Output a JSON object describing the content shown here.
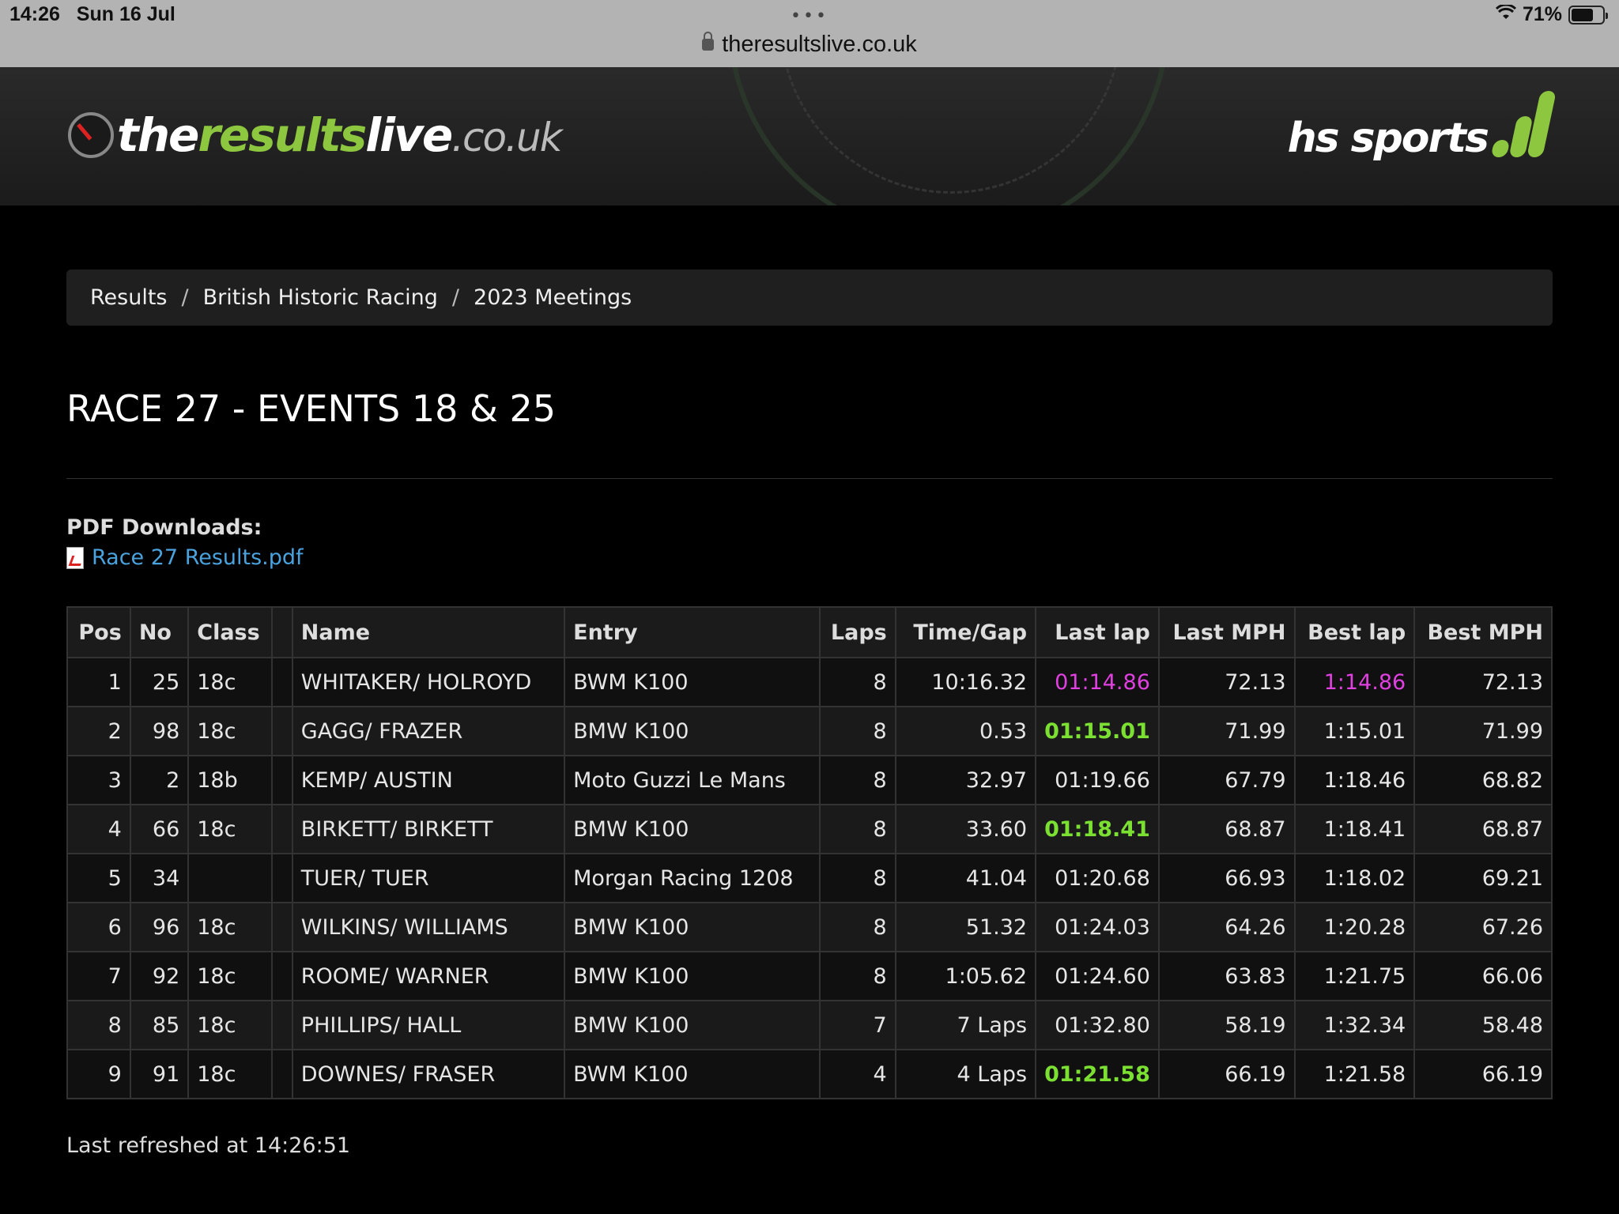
{
  "status_bar": {
    "time": "14:26",
    "date": "Sun 16 Jul",
    "battery": "71%",
    "battery_level": 0.71
  },
  "browser": {
    "url": "theresultslive.co.uk",
    "menu": "•••"
  },
  "header": {
    "logo": {
      "part1": "the",
      "part2": "results",
      "part3": "live",
      "part4": ".co.uk"
    },
    "partner_logo": "hs sports"
  },
  "breadcrumb": {
    "items": [
      "Results",
      "British Historic Racing",
      "2023 Meetings"
    ],
    "separator": "/"
  },
  "page_title": "RACE 27 - EVENTS 18 & 25",
  "downloads": {
    "label": "PDF Downloads:",
    "file": "Race 27 Results.pdf"
  },
  "table": {
    "headers": [
      "Pos",
      "No",
      "Class",
      "",
      "Name",
      "Entry",
      "Laps",
      "Time/Gap",
      "Last lap",
      "Last MPH",
      "Best lap",
      "Best MPH"
    ],
    "rows": [
      {
        "pos": "1",
        "no": "25",
        "class": "18c",
        "name": "WHITAKER/ HOLROYD",
        "entry": "BWM K100",
        "laps": "8",
        "time": "10:16.32",
        "last_lap": "01:14.86",
        "last_lap_style": "purple",
        "last_mph": "72.13",
        "best_lap": "1:14.86",
        "best_lap_style": "purple",
        "best_mph": "72.13"
      },
      {
        "pos": "2",
        "no": "98",
        "class": "18c",
        "name": "GAGG/ FRAZER",
        "entry": "BMW K100",
        "laps": "8",
        "time": "0.53",
        "last_lap": "01:15.01",
        "last_lap_style": "green",
        "last_mph": "71.99",
        "best_lap": "1:15.01",
        "best_lap_style": "",
        "best_mph": "71.99"
      },
      {
        "pos": "3",
        "no": "2",
        "class": "18b",
        "name": "KEMP/ AUSTIN",
        "entry": "Moto Guzzi Le Mans",
        "laps": "8",
        "time": "32.97",
        "last_lap": "01:19.66",
        "last_lap_style": "",
        "last_mph": "67.79",
        "best_lap": "1:18.46",
        "best_lap_style": "",
        "best_mph": "68.82"
      },
      {
        "pos": "4",
        "no": "66",
        "class": "18c",
        "name": "BIRKETT/ BIRKETT",
        "entry": "BMW K100",
        "laps": "8",
        "time": "33.60",
        "last_lap": "01:18.41",
        "last_lap_style": "green",
        "last_mph": "68.87",
        "best_lap": "1:18.41",
        "best_lap_style": "",
        "best_mph": "68.87"
      },
      {
        "pos": "5",
        "no": "34",
        "class": "",
        "name": "TUER/ TUER",
        "entry": "Morgan Racing 1208",
        "laps": "8",
        "time": "41.04",
        "last_lap": "01:20.68",
        "last_lap_style": "",
        "last_mph": "66.93",
        "best_lap": "1:18.02",
        "best_lap_style": "",
        "best_mph": "69.21"
      },
      {
        "pos": "6",
        "no": "96",
        "class": "18c",
        "name": "WILKINS/ WILLIAMS",
        "entry": "BMW K100",
        "laps": "8",
        "time": "51.32",
        "last_lap": "01:24.03",
        "last_lap_style": "",
        "last_mph": "64.26",
        "best_lap": "1:20.28",
        "best_lap_style": "",
        "best_mph": "67.26"
      },
      {
        "pos": "7",
        "no": "92",
        "class": "18c",
        "name": "ROOME/ WARNER",
        "entry": "BMW K100",
        "laps": "8",
        "time": "1:05.62",
        "last_lap": "01:24.60",
        "last_lap_style": "",
        "last_mph": "63.83",
        "best_lap": "1:21.75",
        "best_lap_style": "",
        "best_mph": "66.06"
      },
      {
        "pos": "8",
        "no": "85",
        "class": "18c",
        "name": "PHILLIPS/ HALL",
        "entry": "BMW K100",
        "laps": "7",
        "time": "7 Laps",
        "last_lap": "01:32.80",
        "last_lap_style": "",
        "last_mph": "58.19",
        "best_lap": "1:32.34",
        "best_lap_style": "",
        "best_mph": "58.48"
      },
      {
        "pos": "9",
        "no": "91",
        "class": "18c",
        "name": "DOWNES/ FRASER",
        "entry": "BWM K100",
        "laps": "4",
        "time": "4 Laps",
        "last_lap": "01:21.58",
        "last_lap_style": "green",
        "last_mph": "66.19",
        "best_lap": "1:21.58",
        "best_lap_style": "",
        "best_mph": "66.19"
      }
    ]
  },
  "footer": {
    "refreshed": "Last refreshed at 14:26:51"
  },
  "colors": {
    "accent_green": "#8dc63f",
    "fastest_purple": "#e040e0",
    "personal_best_green": "#7be032",
    "link": "#4aa3df"
  }
}
